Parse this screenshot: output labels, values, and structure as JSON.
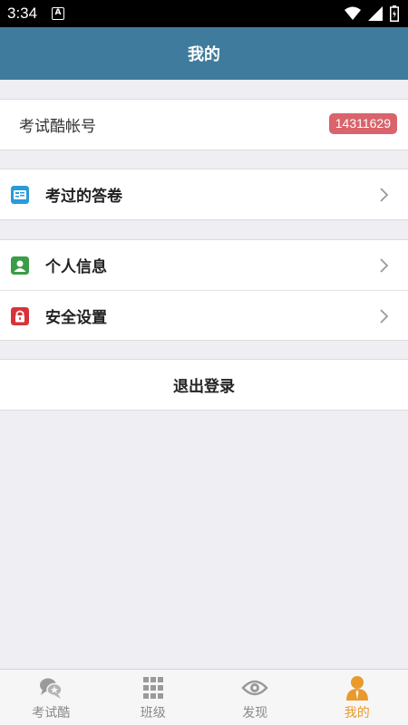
{
  "status_bar": {
    "time": "3:34",
    "notification_letter": "A"
  },
  "header": {
    "title": "我的"
  },
  "account": {
    "label": "考试酷帐号",
    "number": "14311629"
  },
  "menu": {
    "group1": [
      {
        "label": "考过的答卷",
        "icon": "answer-sheet-icon",
        "color": "#2a9ad8"
      }
    ],
    "group2": [
      {
        "label": "个人信息",
        "icon": "person-icon",
        "color": "#3a9d45"
      },
      {
        "label": "安全设置",
        "icon": "lock-icon",
        "color": "#d8323a"
      }
    ]
  },
  "logout": {
    "label": "退出登录"
  },
  "tabs": [
    {
      "label": "考试酷",
      "icon": "chat-bubbles-icon",
      "active": false
    },
    {
      "label": "班级",
      "icon": "grid-icon",
      "active": false
    },
    {
      "label": "发现",
      "icon": "eye-icon",
      "active": false
    },
    {
      "label": "我的",
      "icon": "user-icon",
      "active": true
    }
  ],
  "colors": {
    "header_bg": "#3f7b9c",
    "badge_bg": "#d9646b",
    "active_tab": "#e99a2c",
    "inactive_tab": "#8a8a8a",
    "page_bg": "#eeeef3"
  }
}
